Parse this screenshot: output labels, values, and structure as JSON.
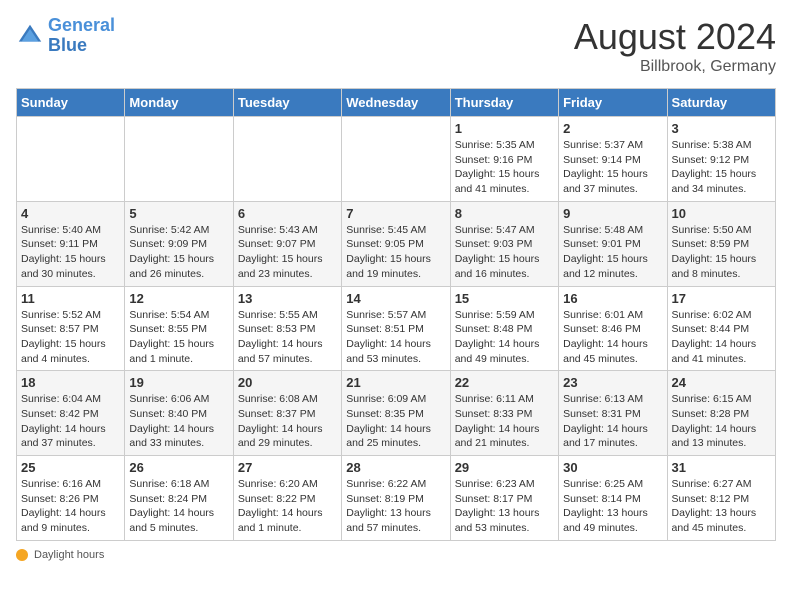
{
  "header": {
    "logo_line1": "General",
    "logo_line2": "Blue",
    "month_title": "August 2024",
    "location": "Billbrook, Germany"
  },
  "calendar": {
    "days_of_week": [
      "Sunday",
      "Monday",
      "Tuesday",
      "Wednesday",
      "Thursday",
      "Friday",
      "Saturday"
    ],
    "weeks": [
      [
        {
          "day": "",
          "info": ""
        },
        {
          "day": "",
          "info": ""
        },
        {
          "day": "",
          "info": ""
        },
        {
          "day": "",
          "info": ""
        },
        {
          "day": "1",
          "info": "Sunrise: 5:35 AM\nSunset: 9:16 PM\nDaylight: 15 hours\nand 41 minutes."
        },
        {
          "day": "2",
          "info": "Sunrise: 5:37 AM\nSunset: 9:14 PM\nDaylight: 15 hours\nand 37 minutes."
        },
        {
          "day": "3",
          "info": "Sunrise: 5:38 AM\nSunset: 9:12 PM\nDaylight: 15 hours\nand 34 minutes."
        }
      ],
      [
        {
          "day": "4",
          "info": "Sunrise: 5:40 AM\nSunset: 9:11 PM\nDaylight: 15 hours\nand 30 minutes."
        },
        {
          "day": "5",
          "info": "Sunrise: 5:42 AM\nSunset: 9:09 PM\nDaylight: 15 hours\nand 26 minutes."
        },
        {
          "day": "6",
          "info": "Sunrise: 5:43 AM\nSunset: 9:07 PM\nDaylight: 15 hours\nand 23 minutes."
        },
        {
          "day": "7",
          "info": "Sunrise: 5:45 AM\nSunset: 9:05 PM\nDaylight: 15 hours\nand 19 minutes."
        },
        {
          "day": "8",
          "info": "Sunrise: 5:47 AM\nSunset: 9:03 PM\nDaylight: 15 hours\nand 16 minutes."
        },
        {
          "day": "9",
          "info": "Sunrise: 5:48 AM\nSunset: 9:01 PM\nDaylight: 15 hours\nand 12 minutes."
        },
        {
          "day": "10",
          "info": "Sunrise: 5:50 AM\nSunset: 8:59 PM\nDaylight: 15 hours\nand 8 minutes."
        }
      ],
      [
        {
          "day": "11",
          "info": "Sunrise: 5:52 AM\nSunset: 8:57 PM\nDaylight: 15 hours\nand 4 minutes."
        },
        {
          "day": "12",
          "info": "Sunrise: 5:54 AM\nSunset: 8:55 PM\nDaylight: 15 hours\nand 1 minute."
        },
        {
          "day": "13",
          "info": "Sunrise: 5:55 AM\nSunset: 8:53 PM\nDaylight: 14 hours\nand 57 minutes."
        },
        {
          "day": "14",
          "info": "Sunrise: 5:57 AM\nSunset: 8:51 PM\nDaylight: 14 hours\nand 53 minutes."
        },
        {
          "day": "15",
          "info": "Sunrise: 5:59 AM\nSunset: 8:48 PM\nDaylight: 14 hours\nand 49 minutes."
        },
        {
          "day": "16",
          "info": "Sunrise: 6:01 AM\nSunset: 8:46 PM\nDaylight: 14 hours\nand 45 minutes."
        },
        {
          "day": "17",
          "info": "Sunrise: 6:02 AM\nSunset: 8:44 PM\nDaylight: 14 hours\nand 41 minutes."
        }
      ],
      [
        {
          "day": "18",
          "info": "Sunrise: 6:04 AM\nSunset: 8:42 PM\nDaylight: 14 hours\nand 37 minutes."
        },
        {
          "day": "19",
          "info": "Sunrise: 6:06 AM\nSunset: 8:40 PM\nDaylight: 14 hours\nand 33 minutes."
        },
        {
          "day": "20",
          "info": "Sunrise: 6:08 AM\nSunset: 8:37 PM\nDaylight: 14 hours\nand 29 minutes."
        },
        {
          "day": "21",
          "info": "Sunrise: 6:09 AM\nSunset: 8:35 PM\nDaylight: 14 hours\nand 25 minutes."
        },
        {
          "day": "22",
          "info": "Sunrise: 6:11 AM\nSunset: 8:33 PM\nDaylight: 14 hours\nand 21 minutes."
        },
        {
          "day": "23",
          "info": "Sunrise: 6:13 AM\nSunset: 8:31 PM\nDaylight: 14 hours\nand 17 minutes."
        },
        {
          "day": "24",
          "info": "Sunrise: 6:15 AM\nSunset: 8:28 PM\nDaylight: 14 hours\nand 13 minutes."
        }
      ],
      [
        {
          "day": "25",
          "info": "Sunrise: 6:16 AM\nSunset: 8:26 PM\nDaylight: 14 hours\nand 9 minutes."
        },
        {
          "day": "26",
          "info": "Sunrise: 6:18 AM\nSunset: 8:24 PM\nDaylight: 14 hours\nand 5 minutes."
        },
        {
          "day": "27",
          "info": "Sunrise: 6:20 AM\nSunset: 8:22 PM\nDaylight: 14 hours\nand 1 minute."
        },
        {
          "day": "28",
          "info": "Sunrise: 6:22 AM\nSunset: 8:19 PM\nDaylight: 13 hours\nand 57 minutes."
        },
        {
          "day": "29",
          "info": "Sunrise: 6:23 AM\nSunset: 8:17 PM\nDaylight: 13 hours\nand 53 minutes."
        },
        {
          "day": "30",
          "info": "Sunrise: 6:25 AM\nSunset: 8:14 PM\nDaylight: 13 hours\nand 49 minutes."
        },
        {
          "day": "31",
          "info": "Sunrise: 6:27 AM\nSunset: 8:12 PM\nDaylight: 13 hours\nand 45 minutes."
        }
      ]
    ]
  },
  "footer": {
    "daylight_label": "Daylight hours"
  }
}
